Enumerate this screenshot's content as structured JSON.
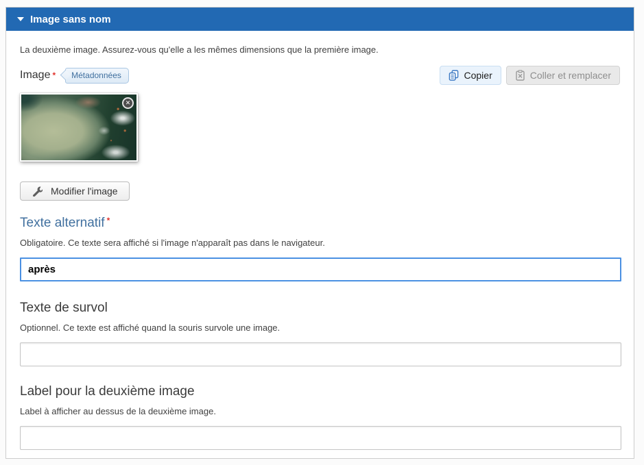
{
  "panel": {
    "title": "Image sans nom",
    "description": "La deuxième image. Assurez-vous qu'elle a les mêmes dimensions que la première image."
  },
  "image_field": {
    "label": "Image",
    "required_mark": "*",
    "badge_label": "Métadonnées",
    "copy_button_label": "Copier",
    "paste_button_label": "Coller et remplacer",
    "edit_button_label": "Modifier l'image",
    "remove_glyph": "✕"
  },
  "alt_field": {
    "label": "Texte alternatif",
    "required_mark": "*",
    "description": "Obligatoire. Ce texte sera affiché si l'image n'apparaît pas dans le navigateur.",
    "value": "après"
  },
  "hover_field": {
    "label": "Texte de survol",
    "description": "Optionnel. Ce texte est affiché quand la souris survole une image.",
    "value": ""
  },
  "label_field": {
    "label": "Label pour la deuxième image",
    "description": "Label à afficher au dessus de la deuxième image.",
    "value": ""
  },
  "icons": {
    "collapse": "caret-down",
    "copy": "copy-pages",
    "paste": "clipboard-x",
    "edit": "wrench",
    "remove": "circle-x"
  },
  "colors": {
    "header_blue": "#2269b3",
    "focus_blue": "#4a90e2",
    "focused_label_blue": "#41709f",
    "required_red": "#e0322c"
  }
}
